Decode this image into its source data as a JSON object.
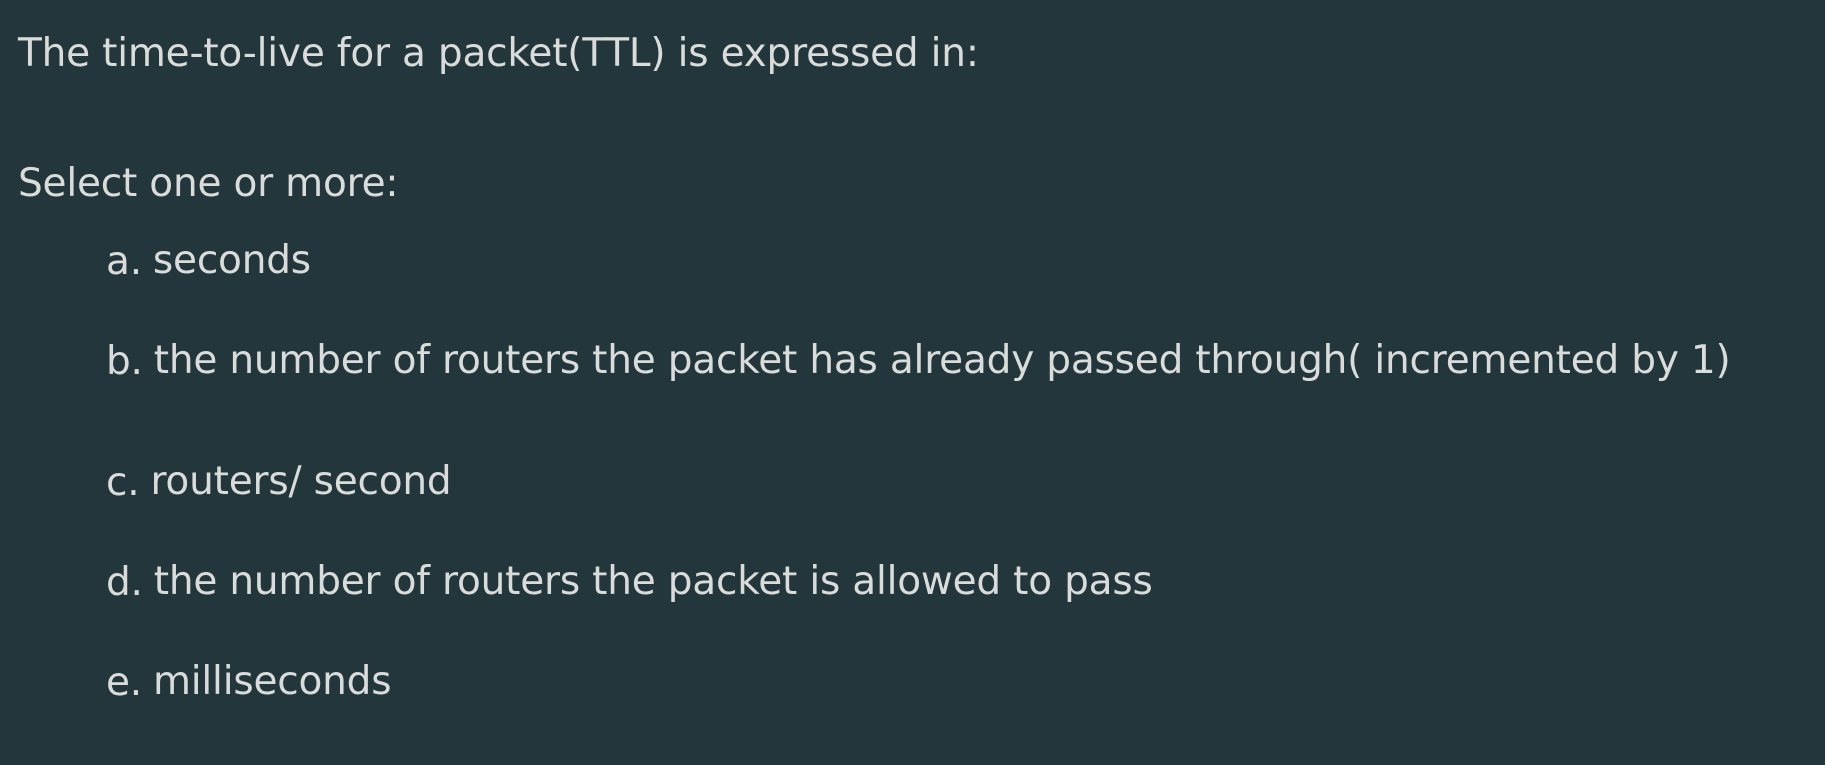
{
  "question": {
    "text": "The time-to-live for a packet(TTL) is expressed in:",
    "prompt": "Select one or more:",
    "answers": [
      {
        "letter": "a.",
        "label": "seconds"
      },
      {
        "letter": "b.",
        "label": "the number of routers the packet has already passed through( incremented by 1)"
      },
      {
        "letter": "c.",
        "label": "routers/ second"
      },
      {
        "letter": "d.",
        "label": "the number of routers the packet is allowed to pass"
      },
      {
        "letter": "e.",
        "label": "milliseconds"
      }
    ]
  },
  "colors": {
    "background": "#22363b",
    "text": "#d9dcda"
  }
}
